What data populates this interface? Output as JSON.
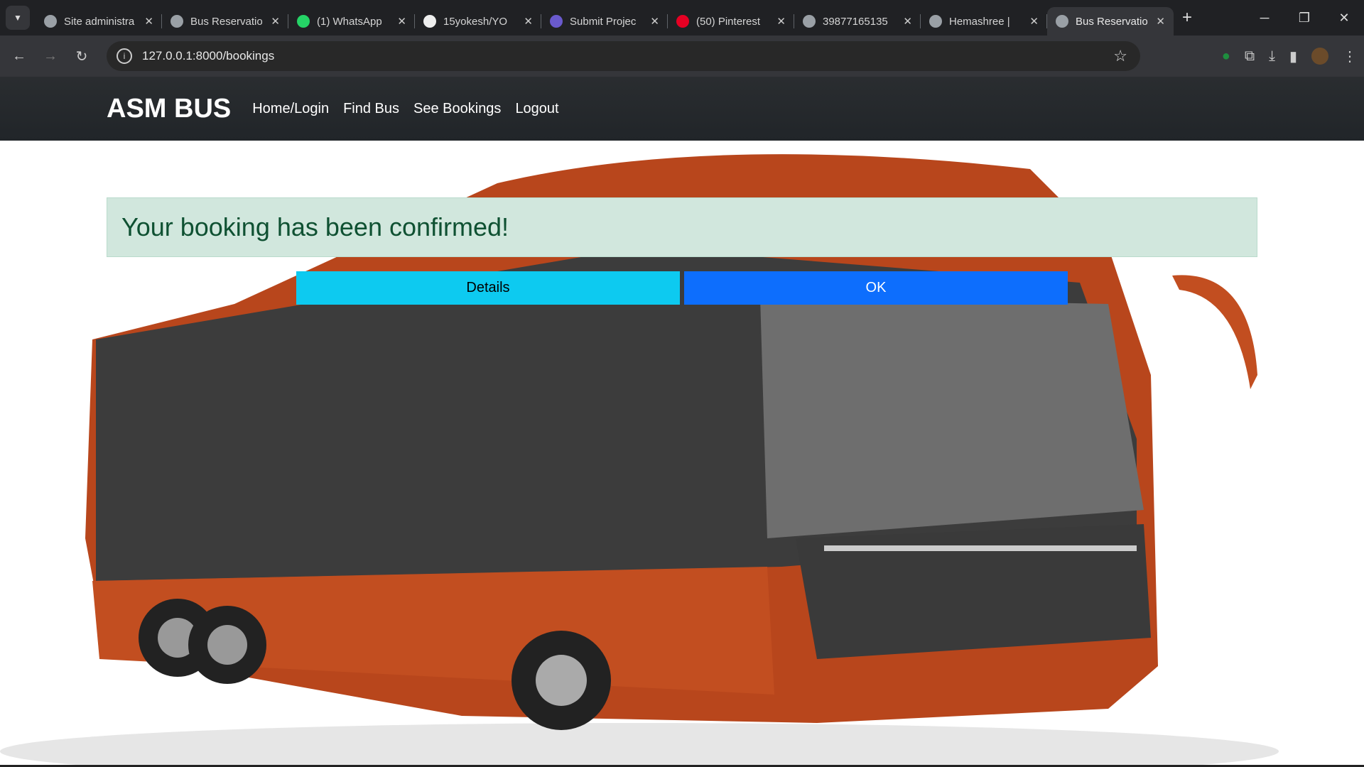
{
  "browser": {
    "tabs": [
      {
        "title": "Site administra",
        "icon": "globe-icon"
      },
      {
        "title": "Bus Reservatio",
        "icon": "globe-icon"
      },
      {
        "title": "(1) WhatsApp",
        "icon": "whatsapp-icon"
      },
      {
        "title": "15yokesh/YO",
        "icon": "github-icon"
      },
      {
        "title": "Submit Projec",
        "icon": "submit-icon"
      },
      {
        "title": "(50) Pinterest",
        "icon": "pinterest-icon"
      },
      {
        "title": "39877165135",
        "icon": "globe-icon"
      },
      {
        "title": "Hemashree | ",
        "icon": "globe-icon"
      },
      {
        "title": "Bus Reservatio",
        "icon": "globe-icon",
        "active": true
      }
    ],
    "url": "127.0.0.1:8000/bookings"
  },
  "navbar": {
    "brand": "ASM BUS",
    "links": [
      "Home/Login",
      "Find Bus",
      "See Bookings",
      "Logout"
    ]
  },
  "alert": {
    "message": "Your booking has been confirmed!",
    "color": "#d1e7dd"
  },
  "buttons": {
    "details": "Details",
    "ok": "OK"
  },
  "colors": {
    "details": "#0dcaf0",
    "ok": "#0d6efd",
    "bus": "#b8461c"
  }
}
